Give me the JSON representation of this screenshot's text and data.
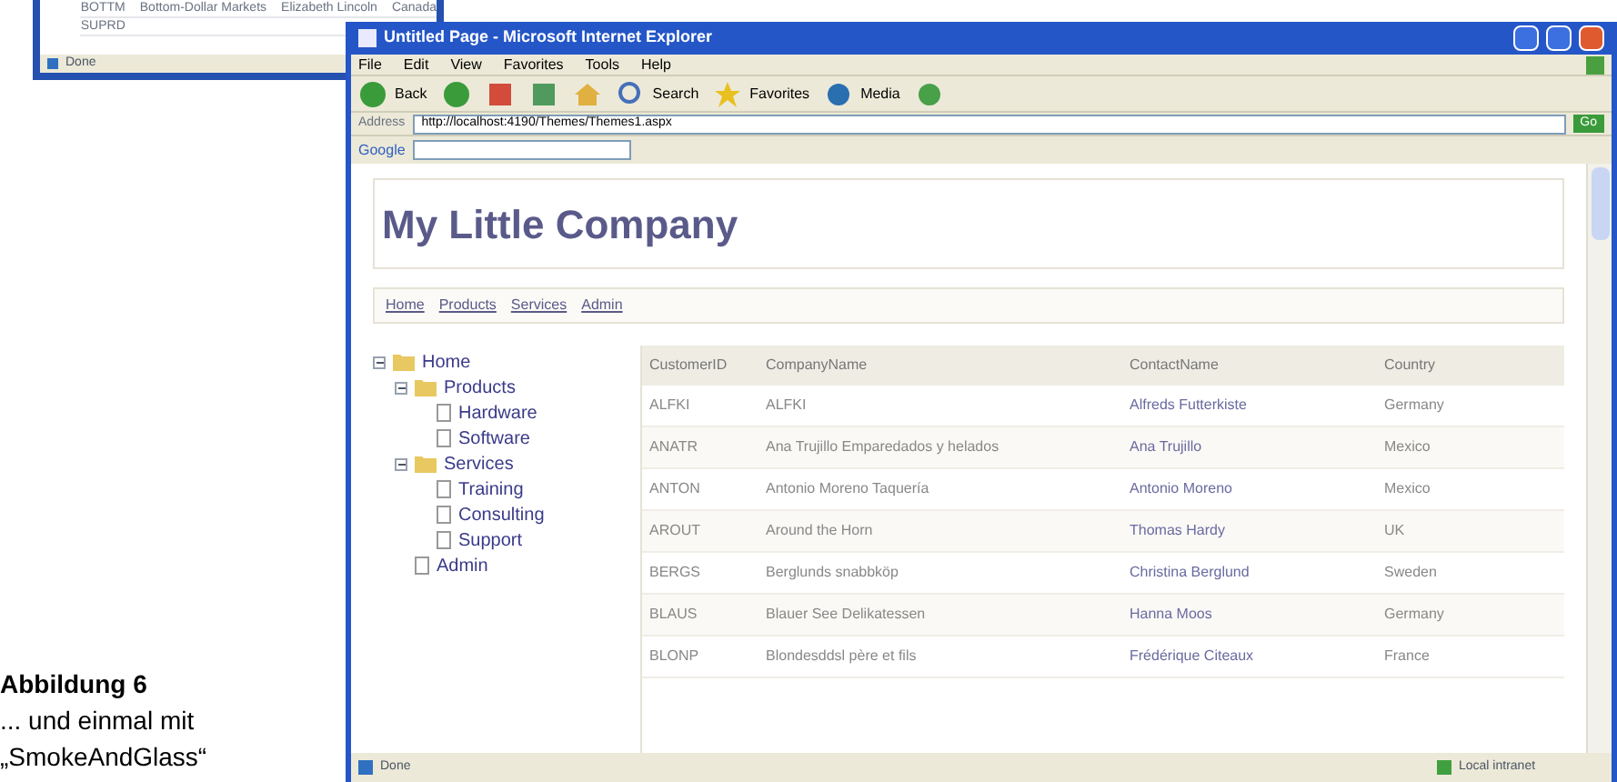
{
  "background_window": {
    "rows": [
      {
        "cells": [
          "BOTTM",
          "Bottom-Dollar Markets",
          "Elizabeth Lincoln",
          "Canada"
        ]
      },
      {
        "cells": [
          "SUPRD"
        ]
      }
    ],
    "status": "Done"
  },
  "caption": {
    "title": "Abbildung 6",
    "lines": [
      "... und einmal mit",
      "„SmokeAndGlass“"
    ]
  },
  "window": {
    "title": "Untitled Page - Microsoft Internet Explorer"
  },
  "menu": [
    "File",
    "Edit",
    "View",
    "Favorites",
    "Tools",
    "Help"
  ],
  "toolbar": [
    {
      "kind": "back",
      "label": "Back"
    },
    {
      "kind": "forward"
    },
    {
      "kind": "stop"
    },
    {
      "kind": "refresh"
    },
    {
      "kind": "home"
    },
    {
      "kind": "search",
      "label": "Search"
    },
    {
      "kind": "favorites",
      "label": "Favorites"
    },
    {
      "kind": "media",
      "label": "Media"
    },
    {
      "kind": "history"
    }
  ],
  "address": {
    "label": "Address",
    "value": "http://localhost:4190/Themes/Themes1.aspx",
    "go": "Go"
  },
  "google": {
    "label": "Google"
  },
  "page": {
    "heading": "My Little Company",
    "nav": [
      "Home",
      "Products",
      "Services",
      "Admin"
    ],
    "tree": [
      {
        "label": "Home",
        "expanded": true,
        "children": [
          {
            "label": "Products",
            "expanded": true,
            "children": [
              {
                "label": "Hardware"
              },
              {
                "label": "Software"
              }
            ]
          },
          {
            "label": "Services",
            "expanded": true,
            "children": [
              {
                "label": "Training"
              },
              {
                "label": "Consulting"
              },
              {
                "label": "Support"
              }
            ]
          },
          {
            "label": "Admin"
          }
        ]
      }
    ],
    "table": {
      "columns": [
        "CustomerID",
        "CompanyName",
        "ContactName",
        "Country"
      ],
      "rows": [
        [
          "ALFKI",
          "ALFKI",
          "Alfreds Futterkiste",
          "Germany"
        ],
        [
          "ANATR",
          "Ana Trujillo Emparedados y helados",
          "Ana Trujillo",
          "Mexico"
        ],
        [
          "ANTON",
          "Antonio Moreno Taquería",
          "Antonio Moreno",
          "Mexico"
        ],
        [
          "AROUT",
          "Around the Horn",
          "Thomas Hardy",
          "UK"
        ],
        [
          "BERGS",
          "Berglunds snabbköp",
          "Christina Berglund",
          "Sweden"
        ],
        [
          "BLAUS",
          "Blauer See Delikatessen",
          "Hanna Moos",
          "Germany"
        ],
        [
          "BLONP",
          "Blondesddsl père et fils",
          "Frédérique Citeaux",
          "France"
        ]
      ]
    }
  },
  "status_bar": {
    "left": "Done",
    "right": "Local intranet"
  }
}
